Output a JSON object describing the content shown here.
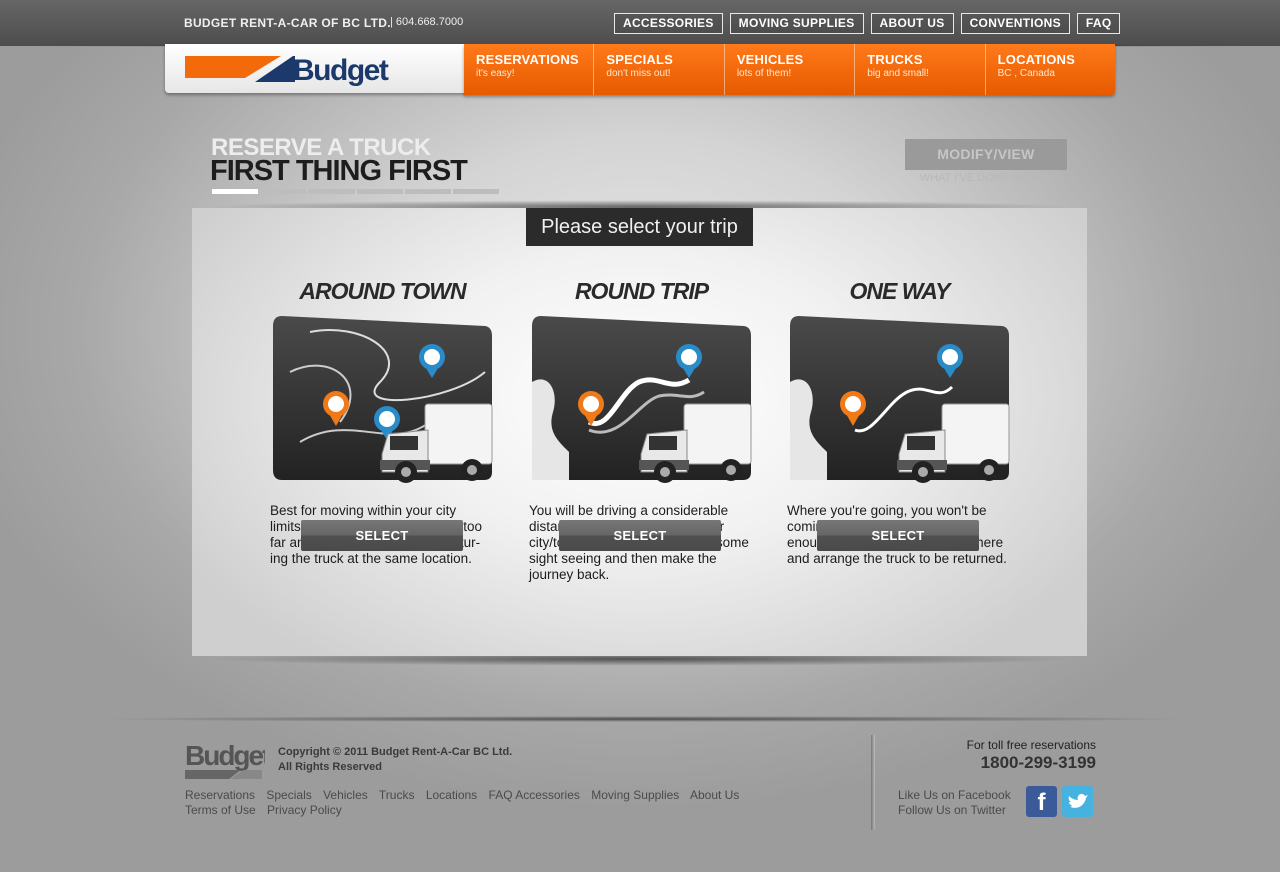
{
  "header": {
    "company": "BUDGET RENT-A-CAR OF BC LTD.",
    "phone": "| 604.668.7000",
    "top_nav": [
      "ACCESSORIES",
      "MOVING SUPPLIES",
      "ABOUT US",
      "CONVENTIONS",
      "FAQ"
    ],
    "logo_text": "Budget",
    "main_nav": [
      {
        "title": "RESERVATIONS",
        "sub": "it's easy!"
      },
      {
        "title": "SPECIALS",
        "sub": "don't miss out!"
      },
      {
        "title": "VEHICLES",
        "sub": "lots of them!"
      },
      {
        "title": "TRUCKS",
        "sub": "big and small!"
      },
      {
        "title": "LOCATIONS",
        "sub": "BC , Canada"
      }
    ]
  },
  "page": {
    "title_line1": "RESERVE A TRUCK",
    "title_line2": "FIRST THING FIRST",
    "progress": {
      "current_step": 1,
      "total_steps": 6
    },
    "modify_label": "MODIFY/VIEW",
    "modify_sub": "WHAT I'VE DONE SO FAR"
  },
  "trip": {
    "header": "Please select your trip",
    "options": [
      {
        "title": "AROUND TOWN",
        "desc": "Best for moving within your city limits. You don't intend on going too far and will be picking up and retur-ing the truck at the same location.",
        "button": "SELECT"
      },
      {
        "title": "ROUND TRIP",
        "desc": "You will be driving a considerable distance such as one from major city/town to another, maybe do some sight seeing and  then make the journey back.",
        "button": "SELECT"
      },
      {
        "title": "ONE WAY",
        "desc": "Where you're going, you won't be coming back, at least not soon enough. You just need to drive there and arrange the truck to be returned.",
        "button": "SELECT"
      }
    ]
  },
  "footer": {
    "logo_text": "Budget",
    "copyright_line1": "Copyright © 2011 Budget Rent-A-Car BC Ltd.",
    "copyright_line2": "All Rights Reserved",
    "links_row1": [
      "Reservations",
      "Specials",
      "Vehicles",
      "Trucks",
      "Locations",
      "FAQ Accessories",
      "Moving Supplies",
      "About Us"
    ],
    "links_row2": [
      "Terms of Use",
      "Privacy Policy"
    ],
    "tollfree_label": "For toll free reservations",
    "tollfree_number": "1800-299-3199",
    "facebook_text": "Like Us on Facebook",
    "twitter_text": "Follow Us on Twitter"
  },
  "colors": {
    "brand_orange": "#f26a0a",
    "brand_navy": "#1b3a6b",
    "dark": "#2b2b2b"
  }
}
